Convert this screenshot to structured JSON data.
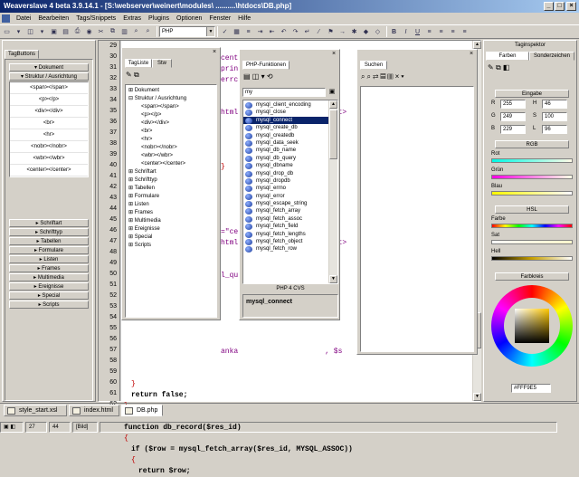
{
  "window": {
    "title": "Weaverslave 4 beta 3.9.14.1 - [S:\\webserver\\weinert\\modules\\ ..........\\htdocs\\DB.php]"
  },
  "menu": [
    "Datei",
    "Bearbeiten",
    "Tags/Snippets",
    "Extras",
    "Plugins",
    "Optionen",
    "Fenster",
    "Hilfe"
  ],
  "toolbar": {
    "language": "PHP"
  },
  "tagbuttons": {
    "tab": "TagButtons",
    "sections": [
      {
        "label": "Dokument",
        "items": []
      },
      {
        "label": "Struktur / Ausrichtung",
        "items": [
          "<span></span>",
          "<p></p>",
          "<div></div>",
          "<br>",
          "<hr>",
          "<nobr></nobr>",
          "<wbr></wbr>",
          "<center></center>"
        ]
      }
    ],
    "more": [
      "Schriftart",
      "Schrifttyp",
      "Tabellen",
      "Formulare",
      "Listen",
      "Frames",
      "Multimedia",
      "Ereignisse",
      "Special",
      "Scripts"
    ]
  },
  "editor": {
    "line_numbers": [
      "29",
      "30",
      "31",
      "32",
      "33",
      "34",
      "35",
      "36",
      "37",
      "38",
      "39",
      "40",
      "41",
      "42",
      "43",
      "44",
      "45",
      "46",
      "47",
      "48",
      "49",
      "50",
      "51",
      "52",
      "53",
      "54",
      "55",
      "56",
      "57",
      "58",
      "59",
      "60",
      "61",
      "62",
      "63"
    ],
    "visible_fragments": {
      "l30": "cent",
      "l31": "print",
      "l32": "errc",
      "l35": "html",
      "l35b": "</tt>",
      "l40": "}",
      "l45": "=\"ce",
      "l46": "html",
      "l46b": "</tt>",
      "l49": "l_qu",
      "l56": "anka",
      "l56b": ", $s",
      "l60": "}",
      "l61": "return false;",
      "l62": "}",
      "l64": "function db_record($res_id)",
      "l65": "{",
      "l66": "if ($row = mysql_fetch_array($res_id, MYSQL_ASSOC))",
      "l67": "{",
      "l68": "return $row;"
    }
  },
  "tagliste": {
    "tabs": [
      "TagListe",
      "Stw"
    ],
    "tree": [
      {
        "t": "Dokument",
        "l": 0
      },
      {
        "t": "Struktur / Ausrichtung",
        "l": 0
      },
      {
        "t": "<span></span>",
        "l": 2
      },
      {
        "t": "<p></p>",
        "l": 2
      },
      {
        "t": "<div></div>",
        "l": 2
      },
      {
        "t": "<br>",
        "l": 2
      },
      {
        "t": "<hr>",
        "l": 2
      },
      {
        "t": "<nobr></nobr>",
        "l": 2
      },
      {
        "t": "<wbr></wbr>",
        "l": 2
      },
      {
        "t": "<center></center>",
        "l": 2
      },
      {
        "t": "Schriftart",
        "l": 0
      },
      {
        "t": "Schrifttyp",
        "l": 0
      },
      {
        "t": "Tabellen",
        "l": 0
      },
      {
        "t": "Formulare",
        "l": 0
      },
      {
        "t": "Listen",
        "l": 0
      },
      {
        "t": "Frames",
        "l": 0
      },
      {
        "t": "Multimedia",
        "l": 0
      },
      {
        "t": "Ereignisse",
        "l": 0
      },
      {
        "t": "Special",
        "l": 0
      },
      {
        "t": "Scripts",
        "l": 0
      }
    ]
  },
  "phpfunc": {
    "tab": "PHP-Funktionen",
    "filter": "my",
    "items": [
      "mysql_client_encoding",
      "mysql_close",
      "mysql_connect",
      "mysql_create_db",
      "mysql_createdb",
      "mysql_data_seek",
      "mysql_db_name",
      "mysql_db_query",
      "mysql_dbname",
      "mysql_drop_db",
      "mysql_dropdb",
      "mysql_errno",
      "mysql_error",
      "mysql_escape_string",
      "mysql_fetch_array",
      "mysql_fetch_assoc",
      "mysql_fetch_field",
      "mysql_fetch_lengths",
      "mysql_fetch_object",
      "mysql_fetch_row"
    ],
    "selected": "mysql_connect",
    "version": "PHP 4 CVS",
    "signature": "mysql_connect"
  },
  "suchen": {
    "tab": "Suchen"
  },
  "taginspektor": {
    "title": "Taginspektor",
    "tabs": [
      "Farben",
      "Sonderzeichen"
    ],
    "eingabe": {
      "label": "Eingabe",
      "R": "255",
      "G": "249",
      "B": "229",
      "H": "46",
      "S": "100",
      "L": "96"
    },
    "rgb": {
      "label": "RGB",
      "rot": "Rot",
      "gruen": "Grün",
      "blau": "Blau"
    },
    "hsl": {
      "label": "HSL",
      "farbe": "Farbe",
      "sat": "Sat",
      "hell": "Hell"
    },
    "farbkreis": {
      "label": "Farbkreis"
    },
    "hex": "#FFF9E5"
  },
  "doctabs": [
    {
      "label": "style_start.xsl",
      "active": false
    },
    {
      "label": "index.html",
      "active": false
    },
    {
      "label": "DB.php",
      "active": true
    }
  ],
  "status": {
    "line": "27",
    "col": "44",
    "mode": "[Bild]"
  },
  "colors": {
    "accent": "#0a246a",
    "selected": "#0a246a"
  }
}
